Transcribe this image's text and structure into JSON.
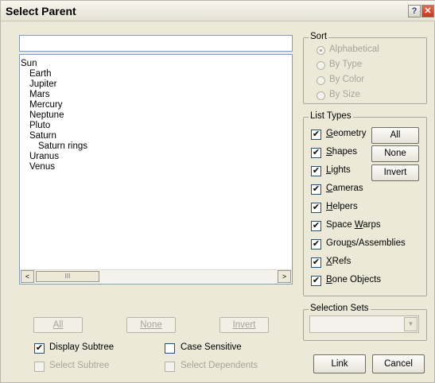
{
  "window": {
    "title": "Select Parent",
    "help_glyph": "?",
    "close_glyph": "✕"
  },
  "search": {
    "value": ""
  },
  "objects": [
    {
      "name": "Sun",
      "depth": 0
    },
    {
      "name": "Earth",
      "depth": 1
    },
    {
      "name": "Jupiter",
      "depth": 1
    },
    {
      "name": "Mars",
      "depth": 1
    },
    {
      "name": "Mercury",
      "depth": 1
    },
    {
      "name": "Neptune",
      "depth": 1
    },
    {
      "name": "Pluto",
      "depth": 1
    },
    {
      "name": "Saturn",
      "depth": 1
    },
    {
      "name": "Saturn rings",
      "depth": 2
    },
    {
      "name": "Uranus",
      "depth": 1
    },
    {
      "name": "Venus",
      "depth": 1
    }
  ],
  "scroll": {
    "left": "<",
    "right": ">",
    "grip": "III"
  },
  "sort": {
    "title": "Sort",
    "options": [
      {
        "label": "Alphabetical",
        "selected": true
      },
      {
        "label": "By Type",
        "selected": false
      },
      {
        "label": "By Color",
        "selected": false
      },
      {
        "label": "By Size",
        "selected": false
      }
    ]
  },
  "list_types": {
    "title": "List Types",
    "items": [
      {
        "label": "Geometry",
        "accel": "G",
        "rest": "eometry",
        "checked": true
      },
      {
        "label": "Shapes",
        "accel": "S",
        "rest": "hapes",
        "checked": true
      },
      {
        "label": "Lights",
        "accel": "L",
        "rest": "ights",
        "checked": true
      },
      {
        "label": "Cameras",
        "accel": "C",
        "rest": "ameras",
        "checked": true
      },
      {
        "label": "Helpers",
        "accel": "H",
        "rest": "elpers",
        "checked": true
      },
      {
        "label": "Space Warps",
        "pre": "Space ",
        "accel": "W",
        "rest": "arps",
        "checked": true
      },
      {
        "label": "Groups/Assemblies",
        "pre": "Grou",
        "accel": "p",
        "rest": "s/Assemblies",
        "checked": true
      },
      {
        "label": "XRefs",
        "accel": "X",
        "rest": "Refs",
        "checked": true
      },
      {
        "label": "Bone Objects",
        "accel": "B",
        "rest": "one Objects",
        "checked": true
      }
    ],
    "buttons": {
      "all": "All",
      "none": "None",
      "invert": "Invert"
    }
  },
  "selection_sets": {
    "title": "Selection Sets",
    "value": "",
    "arrow": "▼"
  },
  "bottom_buttons": {
    "all": "All",
    "none": "None",
    "invert": "Invert"
  },
  "options": {
    "display_subtree": {
      "label": "Display Subtree",
      "checked": true,
      "enabled": true
    },
    "case_sensitive": {
      "label": "Case Sensitive",
      "checked": false,
      "enabled": true
    },
    "select_subtree": {
      "label": "Select Subtree",
      "checked": false,
      "enabled": false
    },
    "select_dependents": {
      "label": "Select Dependents",
      "checked": false,
      "enabled": false
    }
  },
  "actions": {
    "link": "Link",
    "cancel": "Cancel"
  },
  "check_glyph": "✔"
}
